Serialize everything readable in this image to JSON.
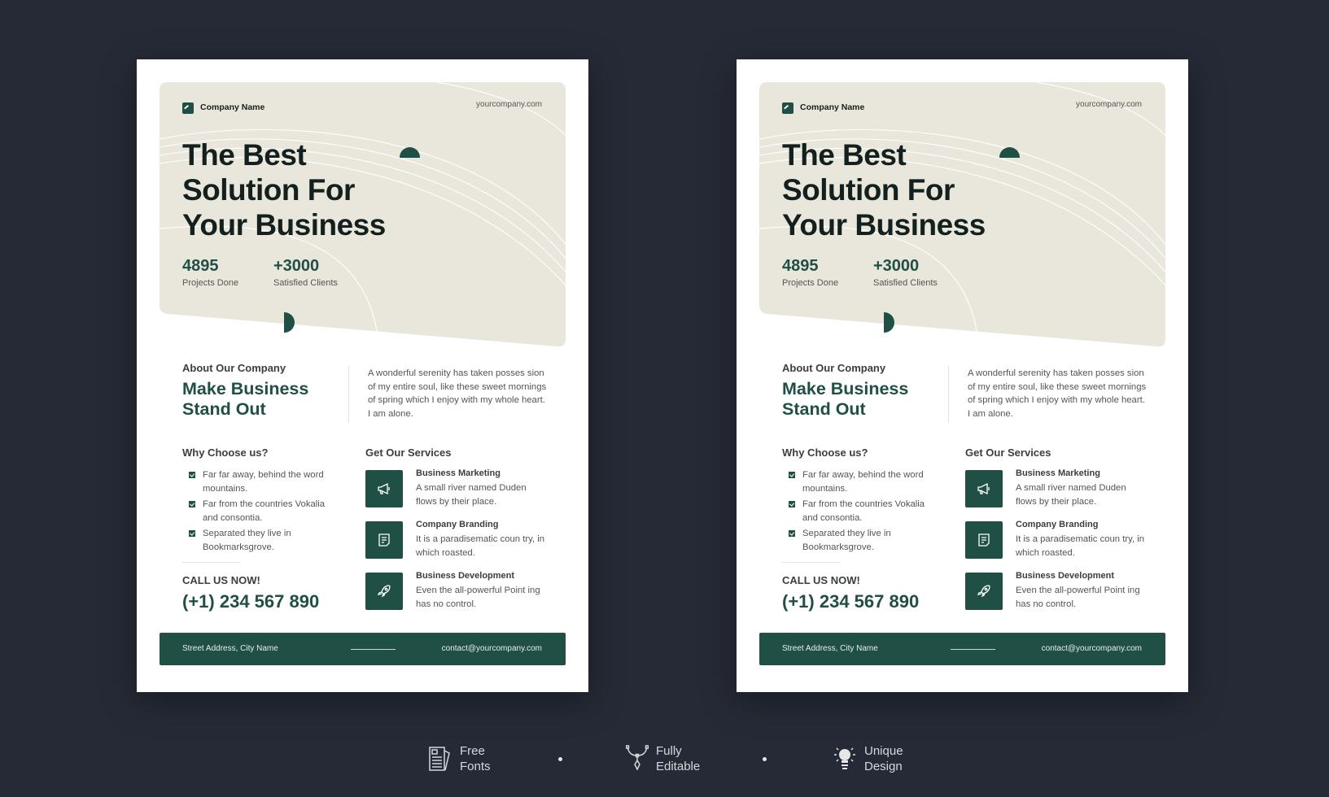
{
  "colors": {
    "background": "#262a36",
    "panel": "#e9e6dc",
    "accent": "#1f4f45"
  },
  "flyer": {
    "company_name": "Company Name",
    "website": "yourcompany.com",
    "title_lines": [
      "The Best",
      "Solution For",
      "Your Business"
    ],
    "stats": [
      {
        "value": "4895",
        "label": "Projects Done"
      },
      {
        "value": "+3000",
        "label": "Satisfied Clients"
      }
    ],
    "about": {
      "heading": "About Our Company",
      "title_lines": [
        "Make Business",
        "Stand Out"
      ],
      "text": "A wonderful serenity has taken posses sion of my entire soul, like these sweet mornings of spring which I enjoy with my whole heart. I am alone."
    },
    "why": {
      "heading": "Why Choose us?",
      "items": [
        "Far far away, behind the word mountains.",
        "Far from the countries Vokalia and consontia.",
        "Separated they live in Bookmarksgrove."
      ]
    },
    "call": {
      "heading": "CALL US NOW!",
      "phone": "(+1) 234 567 890"
    },
    "services": {
      "heading": "Get Our Services",
      "items": [
        {
          "icon": "megaphone-icon",
          "title": "Business Marketing",
          "text": "A small river named Duden flows by their place."
        },
        {
          "icon": "document-icon",
          "title": "Company Branding",
          "text": "It is a paradisematic coun try, in which roasted."
        },
        {
          "icon": "rocket-icon",
          "title": "Business Development",
          "text": "Even the all-powerful Point ing has no control."
        }
      ]
    },
    "footer": {
      "address": "Street Address, City Name",
      "email": "contact@yourcompany.com"
    }
  },
  "features": [
    {
      "icon": "newspaper-icon",
      "lines": [
        "Free",
        "Fonts"
      ]
    },
    {
      "icon": "pen-tool-icon",
      "lines": [
        "Fully",
        "Editable"
      ]
    },
    {
      "icon": "lightbulb-icon",
      "lines": [
        "Unique",
        "Design"
      ]
    }
  ]
}
